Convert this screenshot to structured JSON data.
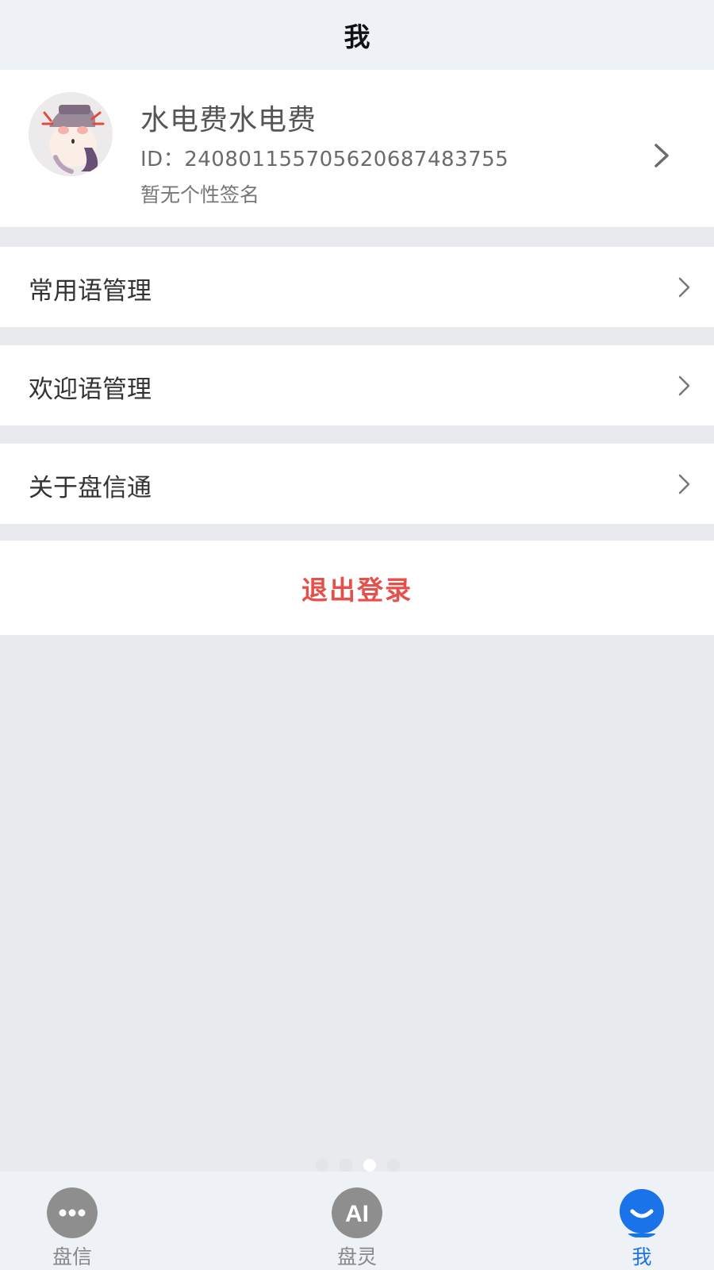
{
  "header": {
    "title": "我"
  },
  "profile": {
    "name": "水电费水电费",
    "id_text": "ID：24080115570562068748​3755",
    "signature": "暂无个性签名"
  },
  "menu": [
    {
      "label": "常用语管理"
    },
    {
      "label": "欢迎语管理"
    },
    {
      "label": "关于盘信通"
    }
  ],
  "logout": {
    "label": "退出登录"
  },
  "pager": {
    "pages": 4,
    "active_index": 2
  },
  "tabbar": {
    "tabs": [
      {
        "label": "盘信",
        "icon": "chat-bubble-icon",
        "active": false
      },
      {
        "label": "盘灵",
        "icon": "ai-icon",
        "icon_text": "AI",
        "active": false
      },
      {
        "label": "我",
        "icon": "smile-profile-icon",
        "active": true
      }
    ]
  },
  "colors": {
    "accent": "#1a73e8",
    "danger": "#e5514a",
    "background": "#e9eaed",
    "header_bg": "#eef1f6"
  }
}
